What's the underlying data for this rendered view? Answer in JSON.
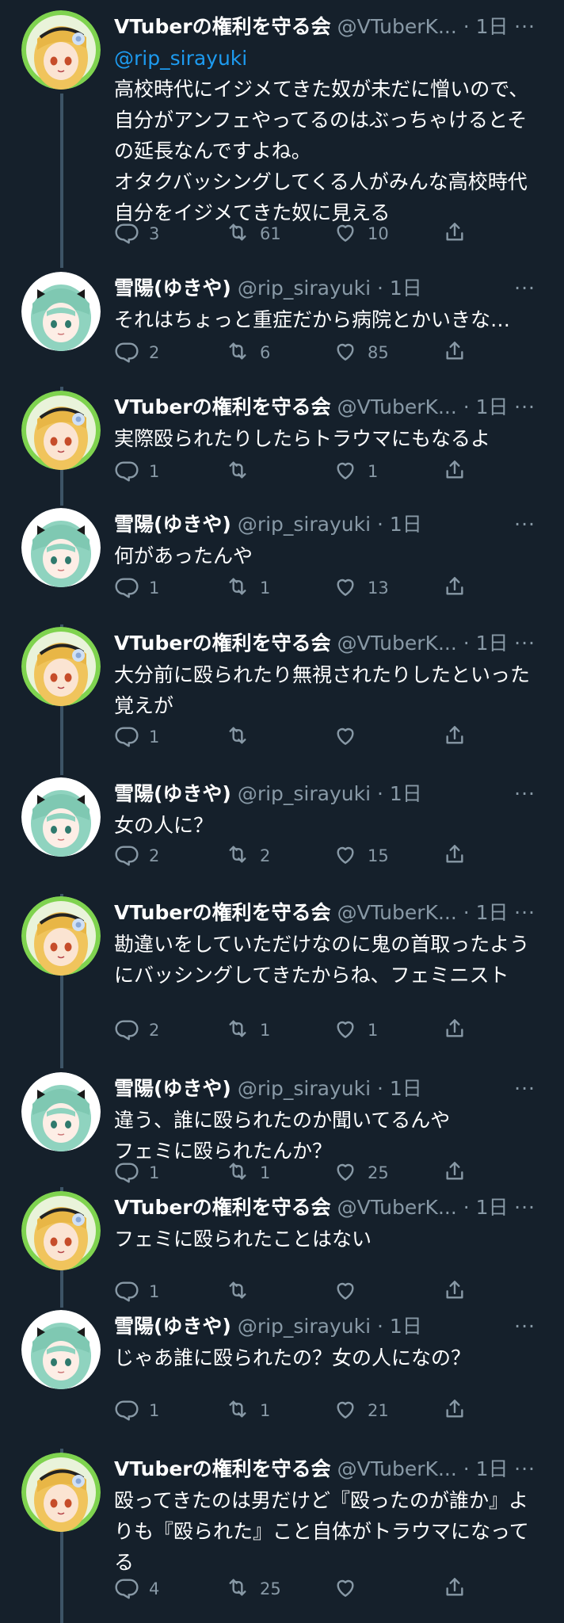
{
  "labels": {
    "name_vtuber": "VTuberの権利を守る会",
    "handle_vtuber": "@VTuberK... · 1日",
    "name_yukiya": "雪陽(ゆきや)",
    "handle_yukiya": "@rip_sirayuki · 1日",
    "more": "···"
  },
  "tweets": [
    {
      "author": "vtuber",
      "mention": "@rip_sirayuki",
      "text": "高校時代にイジメてきた奴が未だに憎いので、自分がアンフェやってるのはぶっちゃけるとその延長なんですよね。\nオタクバッシングしてくる人がみんな高校時代自分をイジメてきた奴に見える",
      "replies": "3",
      "retweets": "61",
      "likes": "10"
    },
    {
      "author": "yukiya",
      "text": "それはちょっと重症だから病院とかいきな…",
      "replies": "2",
      "retweets": "6",
      "likes": "85"
    },
    {
      "author": "vtuber",
      "text": "実際殴られたりしたらトラウマにもなるよ",
      "replies": "1",
      "retweets": "",
      "likes": "1"
    },
    {
      "author": "yukiya",
      "text": "何があったんや",
      "replies": "1",
      "retweets": "1",
      "likes": "13"
    },
    {
      "author": "vtuber",
      "text": "大分前に殴られたり無視されたりしたといった覚えが",
      "replies": "1",
      "retweets": "",
      "likes": ""
    },
    {
      "author": "yukiya",
      "text": "女の人に？",
      "replies": "2",
      "retweets": "2",
      "likes": "15"
    },
    {
      "author": "vtuber",
      "text": "勘違いをしていただけなのに鬼の首取ったようにバッシングしてきたからね、フェミニスト",
      "replies": "2",
      "retweets": "1",
      "likes": "1"
    },
    {
      "author": "yukiya",
      "text": "違う、誰に殴られたのか聞いてるんや\nフェミに殴られたんか？",
      "replies": "1",
      "retweets": "1",
      "likes": "25"
    },
    {
      "author": "vtuber",
      "text": "フェミに殴られたことはない",
      "replies": "1",
      "retweets": "",
      "likes": ""
    },
    {
      "author": "yukiya",
      "text": "じゃあ誰に殴られたの？女の人になの？",
      "replies": "1",
      "retweets": "1",
      "likes": "21"
    },
    {
      "author": "vtuber",
      "text": "殴ってきたのは男だけど『殴ったのが誰か』よりも『殴られた』こと自体がトラウマになってる",
      "replies": "4",
      "retweets": "25",
      "likes": ""
    }
  ],
  "icons": {
    "reply": "reply-icon",
    "retweet": "retweet-icon",
    "like": "like-icon",
    "share": "share-icon",
    "more": "more-icon"
  },
  "colors": {
    "background": "#15202b",
    "text": "#ffffff",
    "muted": "#8899a6",
    "mention": "#1d9bf0",
    "thread_line": "#3d5466"
  }
}
